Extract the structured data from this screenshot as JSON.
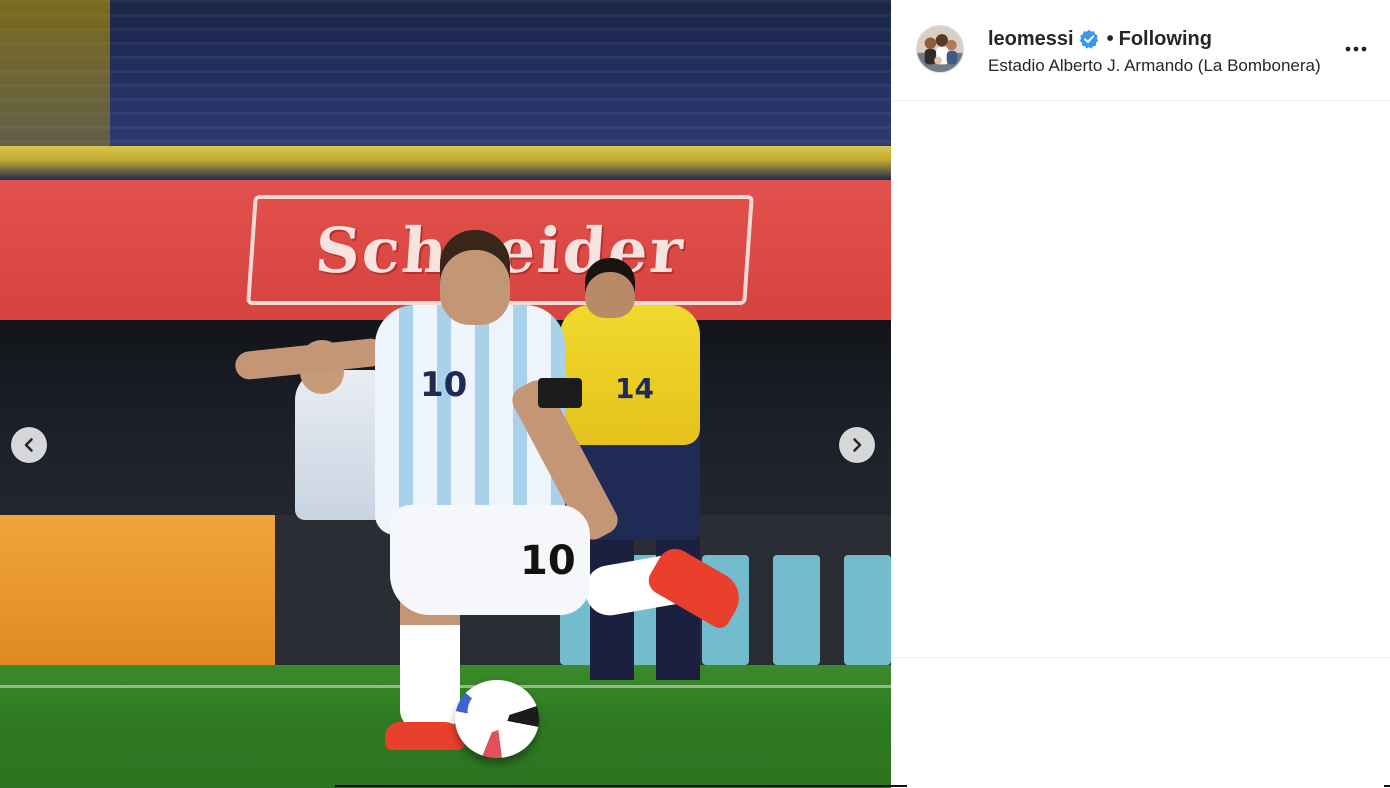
{
  "post": {
    "username": "leomessi",
    "verified": true,
    "separator": "•",
    "follow_status": "Following",
    "location": "Estadio Alberto J. Armando (La Bombonera)",
    "more_options": "More options"
  },
  "media": {
    "banner_text": "Schneider",
    "shirt_number": "10",
    "shorts_number": "10",
    "keeper_number": "14"
  },
  "carousel": {
    "prev_icon": "chevron-left-icon",
    "next_icon": "chevron-right-icon"
  },
  "colors": {
    "verified_blue": "#3897f0",
    "text_primary": "#262626",
    "divider": "#efefef"
  }
}
